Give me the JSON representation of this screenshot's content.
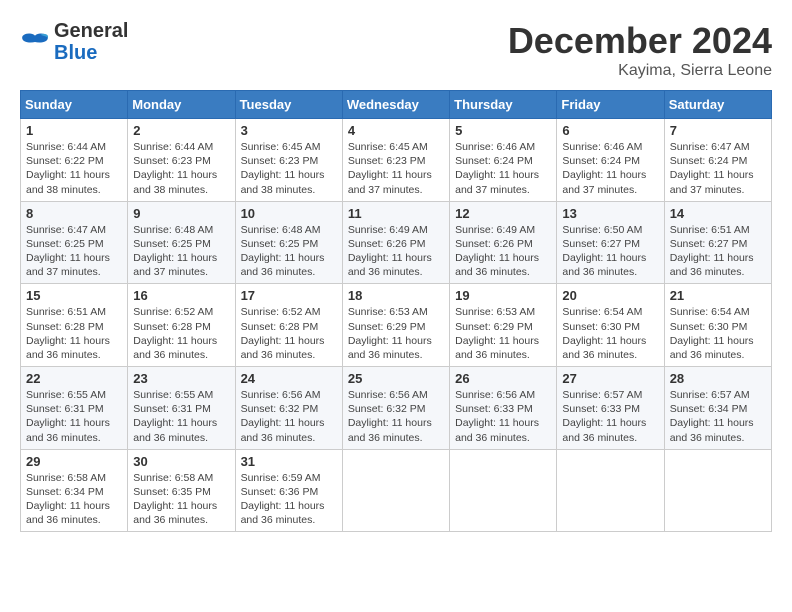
{
  "logo": {
    "line1": "General",
    "line2": "Blue"
  },
  "title": "December 2024",
  "subtitle": "Kayima, Sierra Leone",
  "days_of_week": [
    "Sunday",
    "Monday",
    "Tuesday",
    "Wednesday",
    "Thursday",
    "Friday",
    "Saturday"
  ],
  "weeks": [
    [
      {
        "day": "1",
        "info": "Sunrise: 6:44 AM\nSunset: 6:22 PM\nDaylight: 11 hours\nand 38 minutes."
      },
      {
        "day": "2",
        "info": "Sunrise: 6:44 AM\nSunset: 6:23 PM\nDaylight: 11 hours\nand 38 minutes."
      },
      {
        "day": "3",
        "info": "Sunrise: 6:45 AM\nSunset: 6:23 PM\nDaylight: 11 hours\nand 38 minutes."
      },
      {
        "day": "4",
        "info": "Sunrise: 6:45 AM\nSunset: 6:23 PM\nDaylight: 11 hours\nand 37 minutes."
      },
      {
        "day": "5",
        "info": "Sunrise: 6:46 AM\nSunset: 6:24 PM\nDaylight: 11 hours\nand 37 minutes."
      },
      {
        "day": "6",
        "info": "Sunrise: 6:46 AM\nSunset: 6:24 PM\nDaylight: 11 hours\nand 37 minutes."
      },
      {
        "day": "7",
        "info": "Sunrise: 6:47 AM\nSunset: 6:24 PM\nDaylight: 11 hours\nand 37 minutes."
      }
    ],
    [
      {
        "day": "8",
        "info": "Sunrise: 6:47 AM\nSunset: 6:25 PM\nDaylight: 11 hours\nand 37 minutes."
      },
      {
        "day": "9",
        "info": "Sunrise: 6:48 AM\nSunset: 6:25 PM\nDaylight: 11 hours\nand 37 minutes."
      },
      {
        "day": "10",
        "info": "Sunrise: 6:48 AM\nSunset: 6:25 PM\nDaylight: 11 hours\nand 36 minutes."
      },
      {
        "day": "11",
        "info": "Sunrise: 6:49 AM\nSunset: 6:26 PM\nDaylight: 11 hours\nand 36 minutes."
      },
      {
        "day": "12",
        "info": "Sunrise: 6:49 AM\nSunset: 6:26 PM\nDaylight: 11 hours\nand 36 minutes."
      },
      {
        "day": "13",
        "info": "Sunrise: 6:50 AM\nSunset: 6:27 PM\nDaylight: 11 hours\nand 36 minutes."
      },
      {
        "day": "14",
        "info": "Sunrise: 6:51 AM\nSunset: 6:27 PM\nDaylight: 11 hours\nand 36 minutes."
      }
    ],
    [
      {
        "day": "15",
        "info": "Sunrise: 6:51 AM\nSunset: 6:28 PM\nDaylight: 11 hours\nand 36 minutes."
      },
      {
        "day": "16",
        "info": "Sunrise: 6:52 AM\nSunset: 6:28 PM\nDaylight: 11 hours\nand 36 minutes."
      },
      {
        "day": "17",
        "info": "Sunrise: 6:52 AM\nSunset: 6:28 PM\nDaylight: 11 hours\nand 36 minutes."
      },
      {
        "day": "18",
        "info": "Sunrise: 6:53 AM\nSunset: 6:29 PM\nDaylight: 11 hours\nand 36 minutes."
      },
      {
        "day": "19",
        "info": "Sunrise: 6:53 AM\nSunset: 6:29 PM\nDaylight: 11 hours\nand 36 minutes."
      },
      {
        "day": "20",
        "info": "Sunrise: 6:54 AM\nSunset: 6:30 PM\nDaylight: 11 hours\nand 36 minutes."
      },
      {
        "day": "21",
        "info": "Sunrise: 6:54 AM\nSunset: 6:30 PM\nDaylight: 11 hours\nand 36 minutes."
      }
    ],
    [
      {
        "day": "22",
        "info": "Sunrise: 6:55 AM\nSunset: 6:31 PM\nDaylight: 11 hours\nand 36 minutes."
      },
      {
        "day": "23",
        "info": "Sunrise: 6:55 AM\nSunset: 6:31 PM\nDaylight: 11 hours\nand 36 minutes."
      },
      {
        "day": "24",
        "info": "Sunrise: 6:56 AM\nSunset: 6:32 PM\nDaylight: 11 hours\nand 36 minutes."
      },
      {
        "day": "25",
        "info": "Sunrise: 6:56 AM\nSunset: 6:32 PM\nDaylight: 11 hours\nand 36 minutes."
      },
      {
        "day": "26",
        "info": "Sunrise: 6:56 AM\nSunset: 6:33 PM\nDaylight: 11 hours\nand 36 minutes."
      },
      {
        "day": "27",
        "info": "Sunrise: 6:57 AM\nSunset: 6:33 PM\nDaylight: 11 hours\nand 36 minutes."
      },
      {
        "day": "28",
        "info": "Sunrise: 6:57 AM\nSunset: 6:34 PM\nDaylight: 11 hours\nand 36 minutes."
      }
    ],
    [
      {
        "day": "29",
        "info": "Sunrise: 6:58 AM\nSunset: 6:34 PM\nDaylight: 11 hours\nand 36 minutes."
      },
      {
        "day": "30",
        "info": "Sunrise: 6:58 AM\nSunset: 6:35 PM\nDaylight: 11 hours\nand 36 minutes."
      },
      {
        "day": "31",
        "info": "Sunrise: 6:59 AM\nSunset: 6:36 PM\nDaylight: 11 hours\nand 36 minutes."
      },
      {
        "day": "",
        "info": ""
      },
      {
        "day": "",
        "info": ""
      },
      {
        "day": "",
        "info": ""
      },
      {
        "day": "",
        "info": ""
      }
    ]
  ]
}
